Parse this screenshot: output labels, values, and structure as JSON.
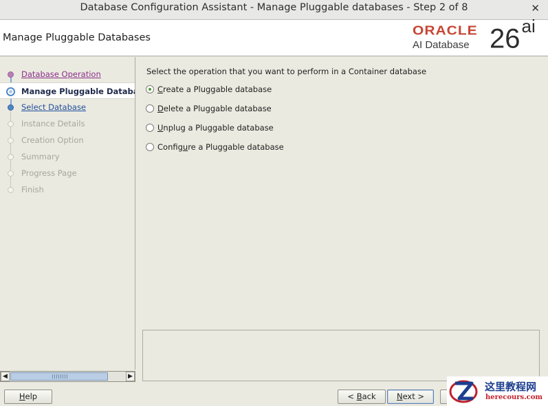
{
  "window": {
    "title": "Database Configuration Assistant - Manage Pluggable databases - Step 2 of 8",
    "close_glyph": "✕"
  },
  "header": {
    "page_title": "Manage Pluggable Databases",
    "logo": {
      "brand": "ORACLE",
      "product": "AI Database",
      "version": "26",
      "version_suffix": "ai"
    }
  },
  "nav": {
    "items": [
      {
        "label": "Database Operation",
        "state": "visited"
      },
      {
        "label": "Manage Pluggable Databases",
        "state": "current"
      },
      {
        "label": "Select Database",
        "state": "link"
      },
      {
        "label": "Instance Details",
        "state": "disabled"
      },
      {
        "label": "Creation Option",
        "state": "disabled"
      },
      {
        "label": "Summary",
        "state": "disabled"
      },
      {
        "label": "Progress Page",
        "state": "disabled"
      },
      {
        "label": "Finish",
        "state": "disabled"
      }
    ]
  },
  "scrollbar": {
    "left_arrow": "◀",
    "right_arrow": "▶"
  },
  "main": {
    "instruction": "Select the operation that you want to perform in a Container database",
    "options": [
      {
        "mnemonic": "C",
        "rest": "reate a Pluggable database",
        "selected": true
      },
      {
        "mnemonic": "D",
        "rest": "elete a Pluggable database",
        "selected": false
      },
      {
        "mnemonic": "U",
        "rest": "nplug a Pluggable database",
        "selected": false
      },
      {
        "pre": "Config",
        "mnemonic": "u",
        "rest": "re a Pluggable database",
        "selected": false
      }
    ]
  },
  "buttons": {
    "help": {
      "mnemonic": "H",
      "rest": "elp"
    },
    "back": {
      "pre": "< ",
      "mnemonic": "B",
      "rest": "ack"
    },
    "next": {
      "mnemonic": "N",
      "rest": "ext >"
    }
  },
  "watermark": {
    "chinese": "这里教程网",
    "domain": "herecours.com"
  },
  "colors": {
    "oracle_red": "#c74634",
    "visited_link": "#8a2f8a",
    "link_blue": "#1f4f9a",
    "disabled_text": "#a6a69e"
  }
}
